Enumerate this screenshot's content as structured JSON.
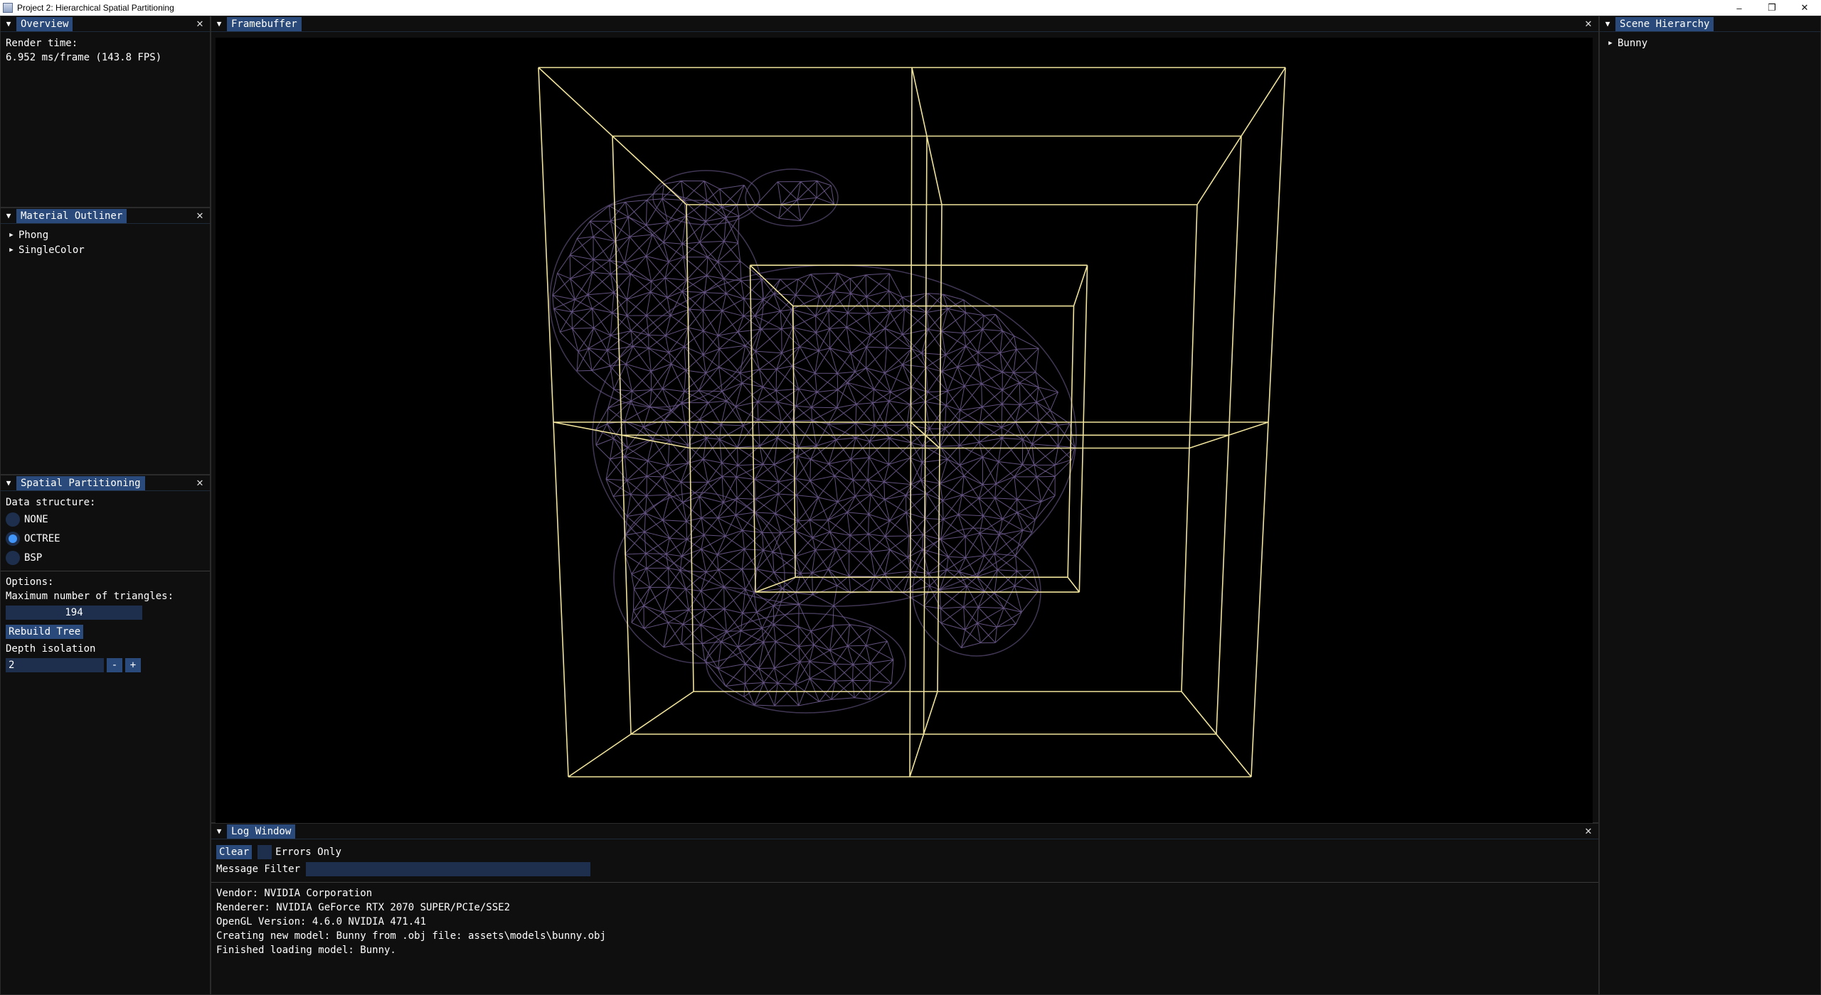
{
  "window": {
    "title": "Project 2: Hierarchical Spatial Partitioning",
    "controls": {
      "minimize": "–",
      "restore": "❐",
      "close": "✕"
    }
  },
  "overview": {
    "title": "Overview",
    "render_label": "Render time:",
    "render_value": "6.952 ms/frame (143.8 FPS)"
  },
  "material_outliner": {
    "title": "Material Outliner",
    "items": [
      {
        "label": "Phong"
      },
      {
        "label": "SingleColor"
      }
    ]
  },
  "spatial": {
    "title": "Spatial Partitioning",
    "data_structure_label": "Data structure:",
    "options": [
      {
        "label": "NONE",
        "selected": false
      },
      {
        "label": "OCTREE",
        "selected": true
      },
      {
        "label": "BSP",
        "selected": false
      }
    ],
    "options_label": "Options:",
    "max_triangles_label": "Maximum number of triangles:",
    "max_triangles_value": "194",
    "rebuild_label": "Rebuild Tree",
    "depth_label": "Depth isolation",
    "depth_value": "2",
    "minus": "-",
    "plus": "+"
  },
  "framebuffer": {
    "title": "Framebuffer",
    "mesh_color": "#6b5a8c",
    "octree_color": "#efe29a",
    "background": "#000000"
  },
  "scene_hierarchy": {
    "title": "Scene Hierarchy",
    "items": [
      {
        "label": "Bunny"
      }
    ]
  },
  "log": {
    "title": "Log Window",
    "clear_label": "Clear",
    "errors_only_label": "Errors Only",
    "filter_label": "Message Filter",
    "lines": [
      "Vendor: NVIDIA Corporation",
      "Renderer: NVIDIA GeForce RTX 2070 SUPER/PCIe/SSE2",
      "OpenGL Version: 4.6.0 NVIDIA 471.41",
      "Creating new model: Bunny from .obj file: assets\\models\\bunny.obj",
      "Finished loading model: Bunny."
    ]
  },
  "icons": {
    "close": "close-icon",
    "collapse": "collapse-triangle-icon",
    "tree_arrow": "tree-arrow-icon"
  }
}
